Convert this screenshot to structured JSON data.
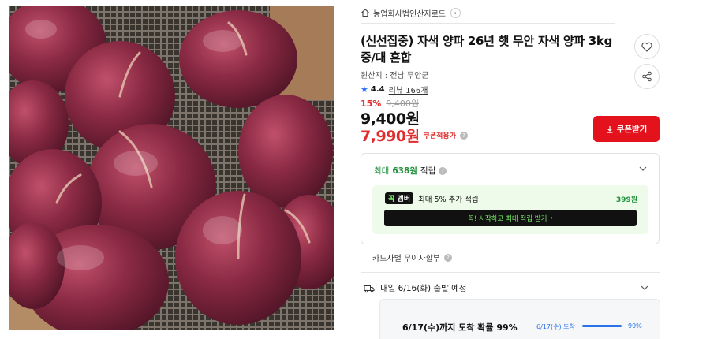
{
  "store": {
    "name": "농업회사법인산지로드",
    "icon": "home-icon",
    "chevron": "›"
  },
  "product": {
    "title": "(신선집중) 자색 양파 26년 햇 무안 자색 양파 3kg 중/대 혼합",
    "origin": "원산지 : 전남 무안군",
    "rating": "4.4",
    "reviews": "리뷰 166개",
    "star": "★"
  },
  "pricing": {
    "discount_pct": "15%",
    "original_price": "9,400원",
    "price": "9,400원",
    "coupon_price": "7,990원",
    "coupon_price_label": "쿠폰적용가",
    "coupon_button": "쿠폰받기",
    "help_glyph": "?"
  },
  "points": {
    "prefix": "최대",
    "amount": "638원",
    "suffix": "적립",
    "member_badge_left": "꼭",
    "member_badge_right": "멤버",
    "member_text": "최대 5% 추가 적립",
    "member_amount": "399원",
    "member_cta": "꼭! 시작하고 최대 적립 받기",
    "member_cta_arrow": "›"
  },
  "card": {
    "text": "카드사별 무이자할부"
  },
  "shipping": {
    "text": "내일 6/16(화) 출발 예정",
    "arrival_main": "6/17(수)까지 도착 확률 99%",
    "arrival_date": "6/17(수) 도착",
    "arrival_pct_text": "99%",
    "arrival_probability": 0.99
  },
  "colors": {
    "accent_red": "#e3121c",
    "price_red": "#e02c2c",
    "points_green": "#1f8f3a",
    "link_blue": "#2a72e8"
  }
}
